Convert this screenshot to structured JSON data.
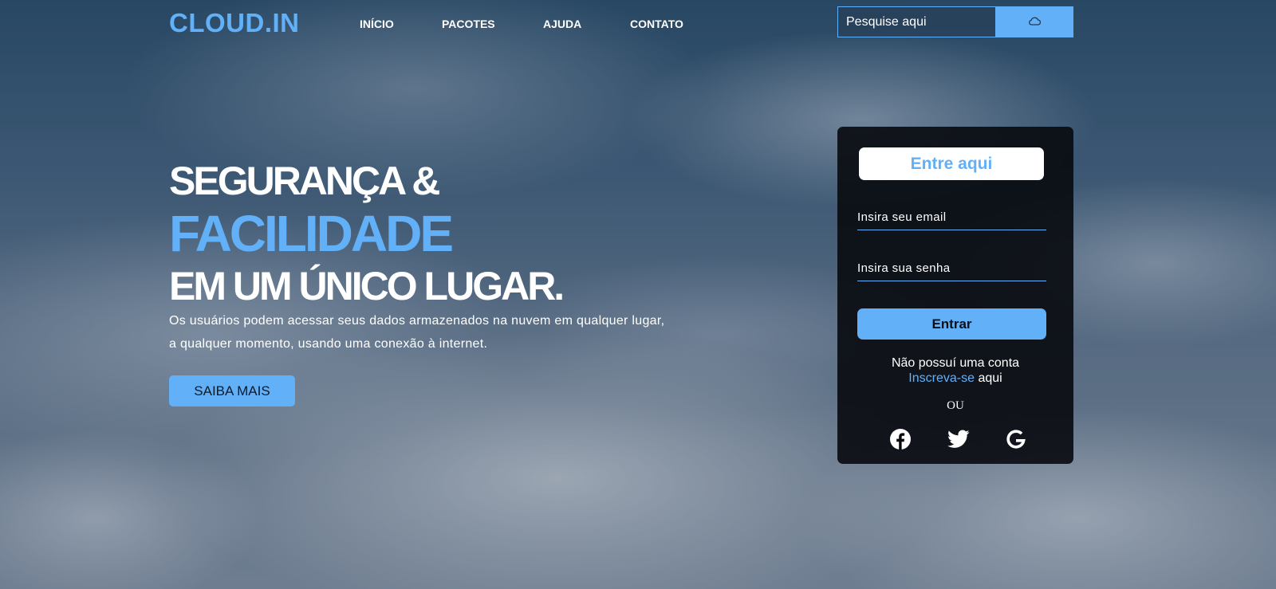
{
  "header": {
    "logo": "CLOUD.IN",
    "nav": [
      "INÍCIO",
      "PACOTES",
      "AJUDA",
      "CONTATO"
    ],
    "search": {
      "placeholder": "Pesquise aqui",
      "icon": "cloud-icon"
    }
  },
  "hero": {
    "line1": "SEGURANÇA &",
    "line2": "FACILIDADE",
    "line3": "EM UM ÚNICO LUGAR.",
    "description_1": "Os usuários podem acessar seus dados armazenados na nuvem em qualquer lugar,",
    "description_2": "a qualquer momento, usando uma conexão à internet.",
    "cta_label": "SAIBA MAIS"
  },
  "login": {
    "title": "Entre aqui",
    "email_placeholder": "Insira seu email",
    "password_placeholder": "Insira sua senha",
    "submit_label": "Entrar",
    "no_account_text": "Não possuí uma conta",
    "signup_link": "Inscreva-se",
    "signup_suffix": " aqui",
    "or_text": "OU",
    "social": [
      "facebook-icon",
      "twitter-icon",
      "google-icon"
    ]
  },
  "colors": {
    "accent": "#62b0f8",
    "card_bg": "#08090d"
  }
}
